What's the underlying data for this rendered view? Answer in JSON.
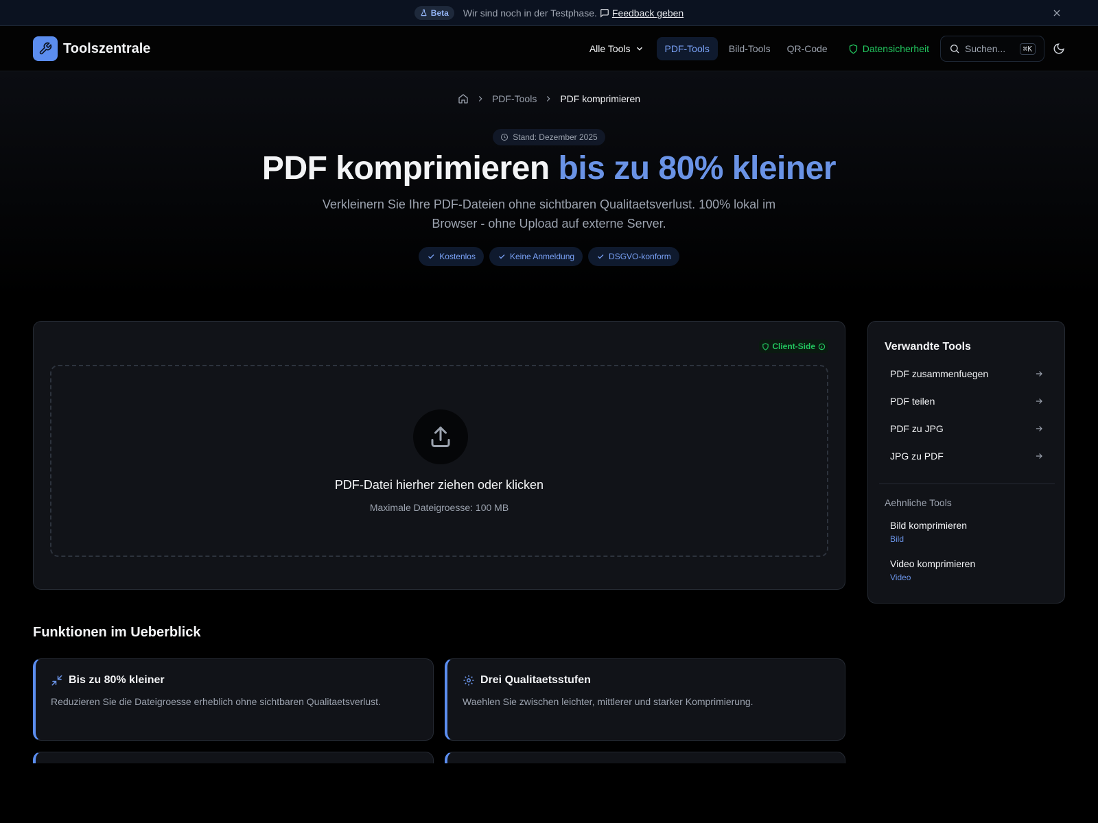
{
  "beta_bar": {
    "badge": "Beta",
    "message": "Wir sind noch in der Testphase.",
    "feedback_label": "Feedback geben"
  },
  "header": {
    "logo_text": "Toolszentrale",
    "nav": {
      "all_tools": "Alle Tools",
      "pdf_tools": "PDF-Tools",
      "image_tools": "Bild-Tools",
      "qr_code": "QR-Code",
      "security": "Datensicherheit"
    },
    "search_placeholder": "Suchen...",
    "search_shortcut": "⌘K"
  },
  "breadcrumb": {
    "parent": "PDF-Tools",
    "current": "PDF komprimieren"
  },
  "hero": {
    "stand": "Stand: Dezember 2025",
    "title_main": "PDF komprimieren",
    "title_accent": "bis zu 80% kleiner",
    "subtitle": "Verkleinern Sie Ihre PDF-Dateien ohne sichtbaren Qualitaetsverlust. 100% lokal im Browser - ohne Upload auf externe Server.",
    "pills": [
      "Kostenlos",
      "Keine Anmeldung",
      "DSGVO-konform"
    ]
  },
  "upload": {
    "badge": "Client-Side",
    "title": "PDF-Datei hierher ziehen oder klicken",
    "subtitle": "Maximale Dateigroesse: 100 MB"
  },
  "sidebar": {
    "title": "Verwandte Tools",
    "links": [
      "PDF zusammenfuegen",
      "PDF teilen",
      "PDF zu JPG",
      "JPG zu PDF"
    ],
    "similar_title": "Aehnliche Tools",
    "similar": [
      {
        "name": "Bild komprimieren",
        "category": "Bild"
      },
      {
        "name": "Video komprimieren",
        "category": "Video"
      }
    ]
  },
  "features": {
    "title": "Funktionen im Ueberblick",
    "items": [
      {
        "title": "Bis zu 80% kleiner",
        "text": "Reduzieren Sie die Dateigroesse erheblich ohne sichtbaren Qualitaetsverlust.",
        "icon": "minimize-icon"
      },
      {
        "title": "Drei Qualitaetsstufen",
        "text": "Waehlen Sie zwischen leichter, mittlerer und starker Komprimierung.",
        "icon": "gear-icon"
      }
    ]
  },
  "colors": {
    "accent": "#6a93e6",
    "success": "#22c55e",
    "background": "#000000",
    "card": "#111318"
  }
}
